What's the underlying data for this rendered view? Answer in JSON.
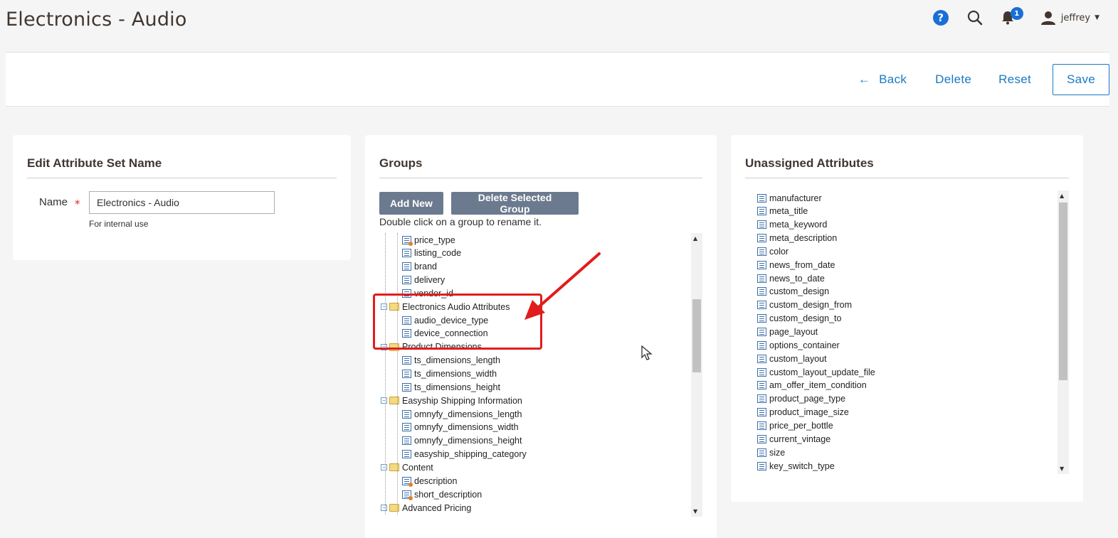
{
  "page": {
    "title": "Electronics - Audio"
  },
  "header": {
    "help_icon": "?",
    "notifications_count": "1",
    "user_name": "jeffrey"
  },
  "actions": {
    "back": "Back",
    "delete": "Delete",
    "reset": "Reset",
    "save": "Save"
  },
  "edit_panel": {
    "title": "Edit Attribute Set Name",
    "name_label": "Name",
    "required_mark": "*",
    "name_value": "Electronics - Audio",
    "note": "For internal use"
  },
  "groups_panel": {
    "title": "Groups",
    "add_new": "Add New",
    "delete_group": "Delete Selected Group",
    "hint": "Double click on a group to rename it.",
    "tree": [
      {
        "type": "leaf",
        "label": "price_type",
        "system": true
      },
      {
        "type": "leaf",
        "label": "listing_code",
        "system": false
      },
      {
        "type": "leaf",
        "label": "brand",
        "system": false
      },
      {
        "type": "leaf",
        "label": "delivery",
        "system": false
      },
      {
        "type": "leaf",
        "label": "vendor_id",
        "system": false
      },
      {
        "type": "group",
        "label": "Electronics Audio Attributes"
      },
      {
        "type": "leaf",
        "label": "audio_device_type",
        "system": false
      },
      {
        "type": "leaf",
        "label": "device_connection",
        "system": false
      },
      {
        "type": "group",
        "label": "Product Dimensions"
      },
      {
        "type": "leaf",
        "label": "ts_dimensions_length",
        "system": false
      },
      {
        "type": "leaf",
        "label": "ts_dimensions_width",
        "system": false
      },
      {
        "type": "leaf",
        "label": "ts_dimensions_height",
        "system": false
      },
      {
        "type": "group",
        "label": "Easyship Shipping Information"
      },
      {
        "type": "leaf",
        "label": "omnyfy_dimensions_length",
        "system": false
      },
      {
        "type": "leaf",
        "label": "omnyfy_dimensions_width",
        "system": false
      },
      {
        "type": "leaf",
        "label": "omnyfy_dimensions_height",
        "system": false
      },
      {
        "type": "leaf",
        "label": "easyship_shipping_category",
        "system": false
      },
      {
        "type": "group",
        "label": "Content"
      },
      {
        "type": "leaf",
        "label": "description",
        "system": true
      },
      {
        "type": "leaf",
        "label": "short_description",
        "system": true
      },
      {
        "type": "group",
        "label": "Advanced Pricing"
      }
    ]
  },
  "unassigned_panel": {
    "title": "Unassigned Attributes",
    "items": [
      "manufacturer",
      "meta_title",
      "meta_keyword",
      "meta_description",
      "color",
      "news_from_date",
      "news_to_date",
      "custom_design",
      "custom_design_from",
      "custom_design_to",
      "page_layout",
      "options_container",
      "custom_layout",
      "custom_layout_update_file",
      "am_offer_item_condition",
      "product_page_type",
      "product_image_size",
      "price_per_bottle",
      "current_vintage",
      "size",
      "key_switch_type"
    ]
  },
  "colors": {
    "accent": "#1979c3",
    "button_grey": "#6c7a8f",
    "annotation_red": "#e11c1c"
  },
  "icons": [
    "help-icon",
    "search-icon",
    "bell-icon",
    "user-icon",
    "back-arrow-icon",
    "folder-icon",
    "attribute-icon"
  ]
}
